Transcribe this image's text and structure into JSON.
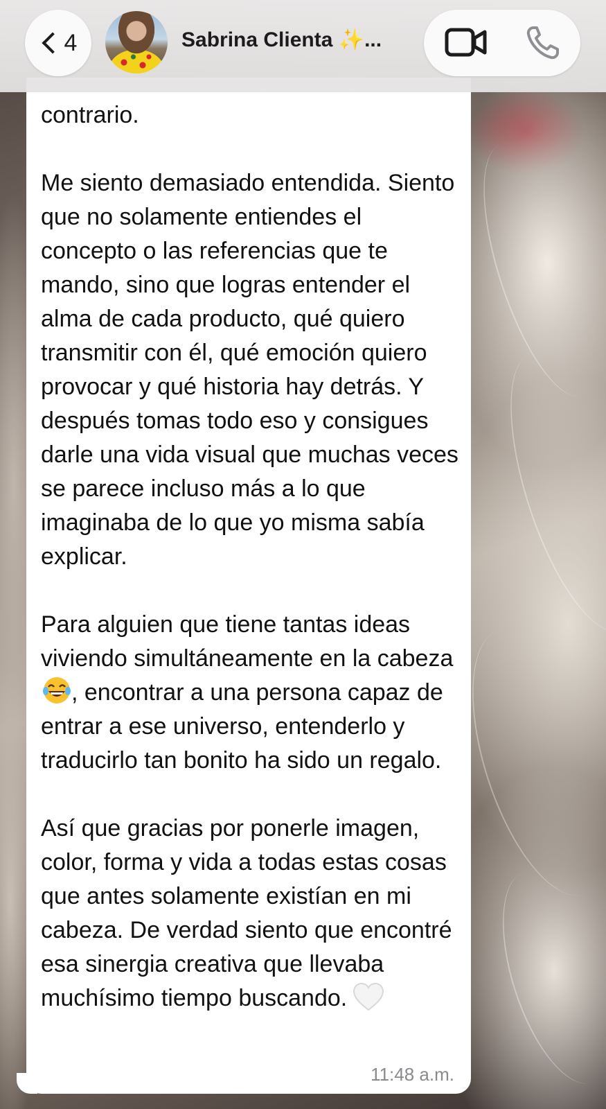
{
  "header": {
    "back_count": "4",
    "contact_name": "Sabrina Clienta ✨...",
    "video_call_icon": "video-camera-icon",
    "voice_call_icon": "phone-icon"
  },
  "message": {
    "paragraph_1": "contrario.",
    "paragraph_2": "Me siento demasiado entendida. Siento que no solamente entiendes el concepto o las referencias que te mando, sino que logras entender el alma de cada producto, qué quiero transmitir con él, qué emoción quiero provocar y qué historia hay detrás. Y después tomas todo eso y consigues darle una vida visual que muchas veces se parece incluso más a lo que imaginaba de lo que yo misma sabía explicar.",
    "paragraph_3_before_emoji": "Para alguien que tiene tantas ideas viviendo simultáneamente en la cabeza ",
    "paragraph_3_after_emoji": ", encontrar a una persona capaz de entrar a ese universo, entenderlo y traducirlo tan bonito ha sido un regalo.",
    "paragraph_4": "Así que gracias por ponerle imagen, color, forma y vida a todas estas cosas que antes solamente existían en mi cabeza. De verdad siento que encontré esa sinergia creativa que llevaba muchísimo tiempo buscando.",
    "timestamp": "11:48 a.m.",
    "emoji_1": "laughing-tears-emoji",
    "emoji_2": "white-heart-emoji"
  }
}
